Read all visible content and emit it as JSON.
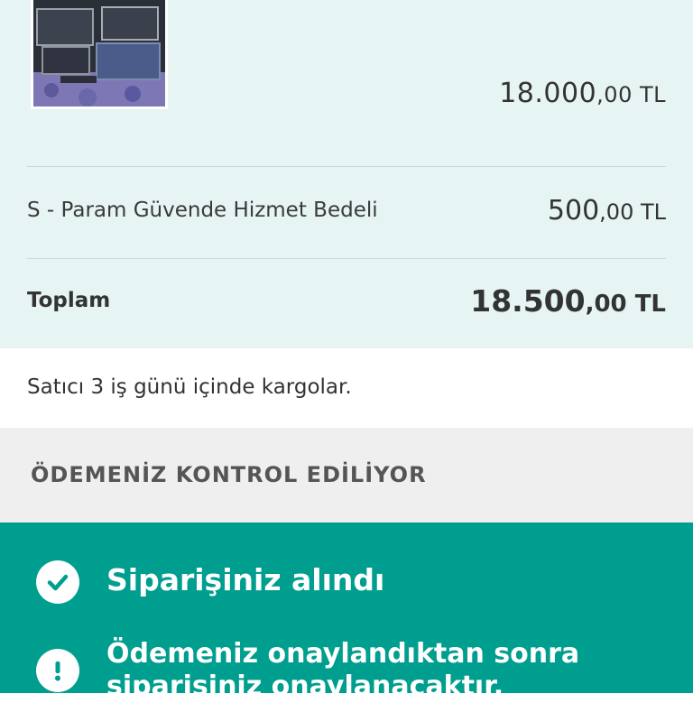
{
  "summary": {
    "product": {
      "image_alt": "product-photo",
      "price_int": "18.000",
      "price_dec": ",00 TL"
    },
    "fee": {
      "label": "S - Param Güvende Hizmet Bedeli",
      "price_int": "500",
      "price_dec": ",00 TL"
    },
    "total": {
      "label": "Toplam",
      "price_int": "18.500",
      "price_dec": ",00 TL"
    }
  },
  "shipping": {
    "text": "Satıcı 3 iş günü içinde kargolar."
  },
  "status": {
    "title": "ÖDEMENİZ KONTROL EDİLİYOR"
  },
  "notice": {
    "items": [
      {
        "icon": "check-circle-icon",
        "text": "Siparişiniz alındı"
      },
      {
        "icon": "exclamation-circle-icon",
        "text_line1": "Ödemeniz onaylandıktan sonra",
        "text_line2": "siparişiniz onaylanacaktır."
      }
    ]
  },
  "colors": {
    "summary_bg": "#e6f4f4",
    "status_bg": "#efefef",
    "notice_bg": "#009e8f",
    "divider": "#bfdfdd"
  }
}
